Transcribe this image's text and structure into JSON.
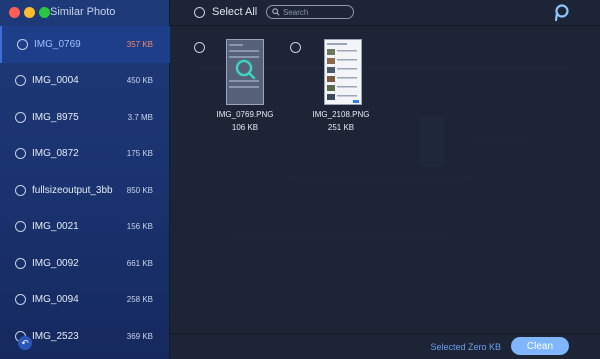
{
  "sidebar": {
    "title": "Similar Photo",
    "items": [
      {
        "name": "IMG_0769",
        "size": "357 KB"
      },
      {
        "name": "IMG_0004",
        "size": "450 KB"
      },
      {
        "name": "IMG_8975",
        "size": "3.7 MB"
      },
      {
        "name": "IMG_0872",
        "size": "175 KB"
      },
      {
        "name": "fullsizeoutput_3bb",
        "size": "850 KB"
      },
      {
        "name": "IMG_0021",
        "size": "156 KB"
      },
      {
        "name": "IMG_0092",
        "size": "661 KB"
      },
      {
        "name": "IMG_0094",
        "size": "258 KB"
      },
      {
        "name": "IMG_2523",
        "size": "369 KB"
      }
    ]
  },
  "toolbar": {
    "select_all": "Select All",
    "search_placeholder": "Search"
  },
  "photos": [
    {
      "filename": "IMG_0769.PNG",
      "size": "106 KB"
    },
    {
      "filename": "IMG_2108.PNG",
      "size": "251 KB"
    }
  ],
  "footer": {
    "selected": "Selected Zero KB",
    "clean_label": "Clean"
  }
}
